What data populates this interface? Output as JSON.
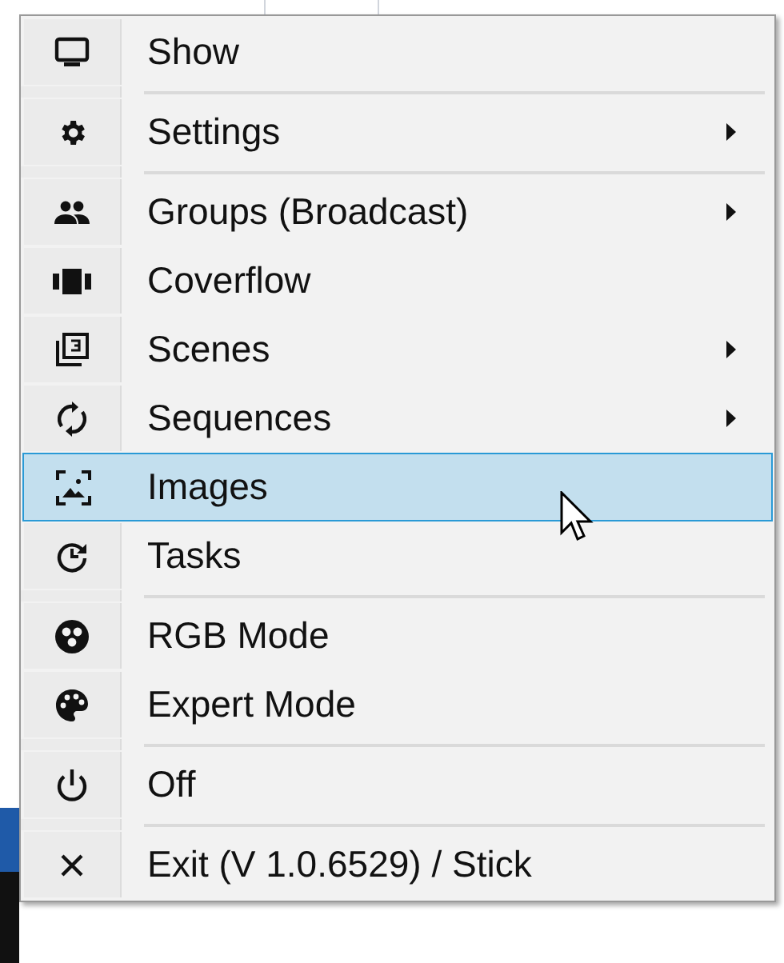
{
  "menu": {
    "sections": [
      {
        "items": [
          {
            "label": "Show",
            "submenu": false,
            "selected": false
          }
        ]
      },
      {
        "items": [
          {
            "label": "Settings",
            "submenu": true,
            "selected": false
          }
        ]
      },
      {
        "items": [
          {
            "label": "Groups (Broadcast)",
            "submenu": true,
            "selected": false
          },
          {
            "label": "Coverflow",
            "submenu": false,
            "selected": false
          },
          {
            "label": "Scenes",
            "submenu": true,
            "selected": false
          },
          {
            "label": "Sequences",
            "submenu": true,
            "selected": false
          },
          {
            "label": "Images",
            "submenu": false,
            "selected": true
          },
          {
            "label": "Tasks",
            "submenu": false,
            "selected": false
          }
        ]
      },
      {
        "items": [
          {
            "label": "RGB Mode",
            "submenu": false,
            "selected": false
          },
          {
            "label": "Expert Mode",
            "submenu": false,
            "selected": false
          }
        ]
      },
      {
        "items": [
          {
            "label": "Off",
            "submenu": false,
            "selected": false
          }
        ]
      },
      {
        "items": [
          {
            "label": "Exit (V 1.0.6529) / Stick",
            "submenu": false,
            "selected": false
          }
        ]
      }
    ]
  }
}
